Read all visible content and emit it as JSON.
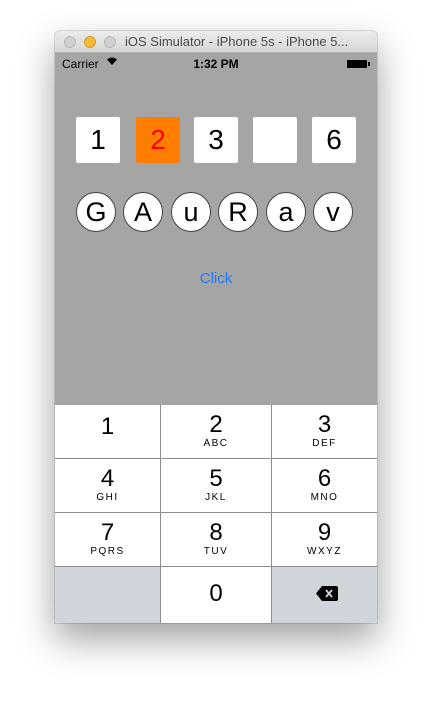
{
  "window": {
    "title": "iOS Simulator - iPhone 5s - iPhone 5..."
  },
  "status_bar": {
    "carrier": "Carrier",
    "time": "1:32 PM"
  },
  "digit_boxes": [
    "1",
    "2",
    "3",
    "",
    "6"
  ],
  "letter_circles": [
    "G",
    "A",
    "u",
    "R",
    "a",
    "v"
  ],
  "click_button": "Click",
  "keypad": {
    "keys": [
      {
        "num": "1",
        "letters": ""
      },
      {
        "num": "2",
        "letters": "ABC"
      },
      {
        "num": "3",
        "letters": "DEF"
      },
      {
        "num": "4",
        "letters": "GHI"
      },
      {
        "num": "5",
        "letters": "JKL"
      },
      {
        "num": "6",
        "letters": "MNO"
      },
      {
        "num": "7",
        "letters": "PQRS"
      },
      {
        "num": "8",
        "letters": "TUV"
      },
      {
        "num": "9",
        "letters": "WXYZ"
      },
      {
        "num": "0",
        "letters": ""
      }
    ]
  },
  "colors": {
    "background": "#a5a5a5",
    "active_box": "#ff7e00",
    "active_text": "#ff0000",
    "link": "#1b7bff"
  }
}
